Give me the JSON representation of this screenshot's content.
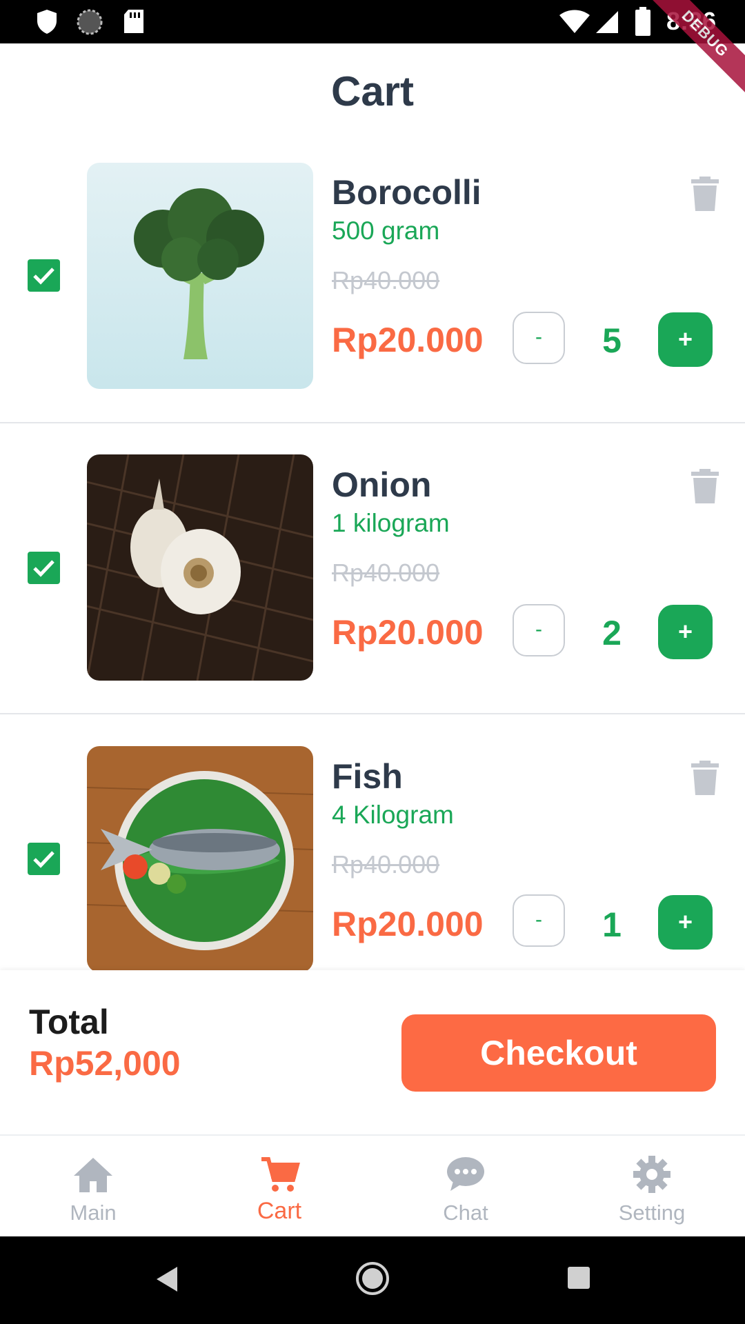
{
  "status_bar": {
    "time": "8:36",
    "debug_label": "DEBUG"
  },
  "header": {
    "title": "Cart"
  },
  "cart": {
    "items": [
      {
        "name": "Borocolli",
        "weight": "500 gram",
        "old_price": "Rp40.000",
        "price": "Rp20.000",
        "quantity": "5",
        "checked": true,
        "minus_label": "-",
        "plus_label": "+"
      },
      {
        "name": "Onion",
        "weight": "1 kilogram",
        "old_price": "Rp40.000",
        "price": "Rp20.000",
        "quantity": "2",
        "checked": true,
        "minus_label": "-",
        "plus_label": "+"
      },
      {
        "name": "Fish",
        "weight": "4 Kilogram",
        "old_price": "Rp40.000",
        "price": "Rp20.000",
        "quantity": "1",
        "checked": true,
        "minus_label": "-",
        "plus_label": "+"
      }
    ]
  },
  "summary": {
    "total_label": "Total",
    "total_value": "Rp52,000",
    "checkout_label": "Checkout"
  },
  "bottom_nav": {
    "items": [
      {
        "label": "Main",
        "icon": "home-icon",
        "active": false
      },
      {
        "label": "Cart",
        "icon": "cart-icon",
        "active": true
      },
      {
        "label": "Chat",
        "icon": "chat-icon",
        "active": false
      },
      {
        "label": "Setting",
        "icon": "gear-icon",
        "active": false
      }
    ]
  },
  "colors": {
    "accent_green": "#1aa757",
    "accent_orange": "#fa6a44",
    "title_dark": "#2e3a4a",
    "inactive_gray": "#b0b6bf"
  }
}
